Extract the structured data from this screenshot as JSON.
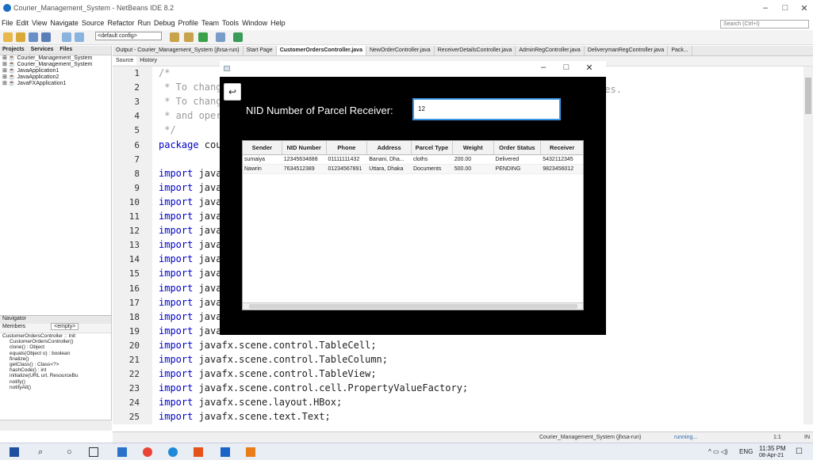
{
  "ide": {
    "title": "Courier_Management_System - NetBeans IDE 8.2",
    "menu": [
      "File",
      "Edit",
      "View",
      "Navigate",
      "Source",
      "Refactor",
      "Run",
      "Debug",
      "Profile",
      "Team",
      "Tools",
      "Window",
      "Help"
    ],
    "search_placeholder": "Search (Ctrl+I)",
    "config": "<default config>"
  },
  "projects": {
    "tabs": [
      "Projects",
      "Services",
      "Files"
    ],
    "items": [
      "Courier_Management_System",
      "Courier_Management_System",
      "JavaApplication1",
      "JavaApplication2",
      "JavaFXApplication1"
    ]
  },
  "navigator": {
    "title": "Navigator",
    "members_label": "Members",
    "filter": "<empty>",
    "class": "CustomerOrdersController :: Init",
    "items": [
      "CustomerOrdersController()",
      "clone() : Object",
      "equals(Object o) : boolean",
      "finalize()",
      "getClass() : Class<?>",
      "hashCode() : int",
      "initialize(URL url, ResourceBu",
      "notify()",
      "notifyAll()"
    ]
  },
  "editor": {
    "tabs": [
      "Output - Courier_Management_System (jfxsa-run)",
      "Start Page",
      "CustomerOrdersController.java",
      "NewOrderController.java",
      "ReceiverDetailsController.java",
      "AdminRegController.java",
      "DeliverymanRegController.java",
      "Pack..."
    ],
    "source_tabs": [
      "Source",
      "History"
    ],
    "line_numbers": [
      "1",
      "2",
      "3",
      "4",
      "5",
      "6",
      "7",
      "8",
      "9",
      "10",
      "11",
      "12",
      "13",
      "14",
      "15",
      "16",
      "17",
      "18",
      "19",
      "20",
      "21",
      "22",
      "23",
      "24",
      "25"
    ],
    "lines": [
      "/*",
      " * To chang",
      " * To chang",
      " * and oper",
      " */",
      "package cou",
      "",
      "import java",
      "import java",
      "import java",
      "import java",
      "import java",
      "import java",
      "import java",
      "import java",
      "import java",
      "import java",
      "import java",
      "import java",
      "import javafx.scene.control.TableCell;",
      "import javafx.scene.control.TableColumn;",
      "import javafx.scene.control.TableView;",
      "import javafx.scene.control.cell.PropertyValueFactory;",
      "import javafx.scene.layout.HBox;",
      "import javafx.scene.text.Text;"
    ],
    "right_fragment": "ies."
  },
  "status": {
    "project": "Courier_Management_System (jfxsa-run)",
    "running": "running...",
    "position": "1:1",
    "mode": "IN"
  },
  "dialog": {
    "label": "NID Number of Parcel Receiver:",
    "nid_value": "12",
    "columns": [
      "Sender",
      "NID Number",
      "Phone",
      "Address",
      "Parcel Type",
      "Weight",
      "Order Status",
      "Receiver"
    ],
    "rows": [
      [
        "sumaiya",
        "12345634888",
        "01111111432",
        "Banani, Dha...",
        "cloths",
        "200.00",
        "Delivered",
        "5432112345"
      ],
      [
        "Nawrin",
        "7634512389",
        "01234567891",
        "Uttara, Dhaka",
        "Documents",
        "500.00",
        "PENDING",
        "9823456012"
      ]
    ]
  },
  "taskbar": {
    "lang": "ENG",
    "time": "11:35 PM",
    "date": "08-Apr-21"
  }
}
